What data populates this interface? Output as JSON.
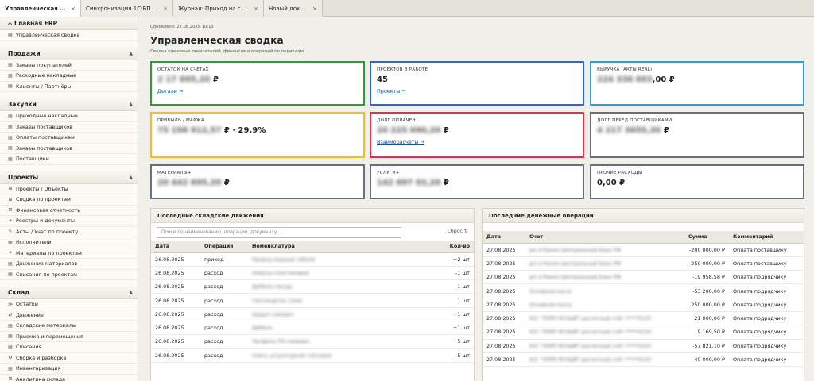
{
  "tabs": [
    {
      "label": "Управленческая сводка",
      "active": true,
      "width": 102
    },
    {
      "label": "Синхронизация 1С:БП — усл...",
      "active": false,
      "width": 116
    },
    {
      "label": "Журнал: Приход на складами",
      "active": false,
      "width": 114
    },
    {
      "label": "Новый документ",
      "active": false,
      "width": 74
    }
  ],
  "sidebar": {
    "home": {
      "title": "Главная ERP",
      "items": [
        "Управленческая сводка"
      ]
    },
    "sections": [
      {
        "title": "Продажи",
        "items": [
          {
            "icon": "▤",
            "label": "Заказы покупателей"
          },
          {
            "icon": "▤",
            "label": "Расходные накладные"
          },
          {
            "icon": "▤",
            "label": "Клиенты / Партнёры"
          }
        ]
      },
      {
        "title": "Закупки",
        "items": [
          {
            "icon": "▤",
            "label": "Приходные накладные"
          },
          {
            "icon": "▤",
            "label": "Заказы поставщиков"
          },
          {
            "icon": "▤",
            "label": "Оплаты поставщикам"
          },
          {
            "icon": "▤",
            "label": "Заказы поставщиков"
          },
          {
            "icon": "▤",
            "label": "Поставщики"
          }
        ]
      },
      {
        "title": "Проекты",
        "items": [
          {
            "icon": "⊞",
            "label": "Проекты / Объекты"
          },
          {
            "icon": "⊞",
            "label": "Сводка по проектам"
          },
          {
            "icon": "⊞",
            "label": "Финансовая отчетность"
          },
          {
            "icon": "✦",
            "label": "Реестры и документы"
          },
          {
            "icon": "✎",
            "label": "Акты / Учет по проекту"
          },
          {
            "icon": "▤",
            "label": "Исполнители"
          },
          {
            "icon": "✦",
            "label": "Материалы по проектам"
          },
          {
            "icon": "▤",
            "label": "Движение материалов"
          },
          {
            "icon": "▤",
            "label": "Списания по проектам"
          }
        ]
      },
      {
        "title": "Склад",
        "items": [
          {
            "icon": "≫",
            "label": "Остатки"
          },
          {
            "icon": "⇄",
            "label": "Движение"
          },
          {
            "icon": "▤",
            "label": "Складские материалы"
          },
          {
            "icon": "▤",
            "label": "Приемка и перемещения"
          },
          {
            "icon": "▤",
            "label": "Списания"
          },
          {
            "icon": "⚙",
            "label": "Сборка и разборка"
          },
          {
            "icon": "▤",
            "label": "Инвентаризация"
          },
          {
            "icon": "⊞",
            "label": "Аналитика склада"
          }
        ]
      }
    ]
  },
  "header": {
    "updated": "Обновлено: 27.08.2025 10:15",
    "title": "Управленческая сводка",
    "subtitle": "Сводка ключевых показателей, финансов и операций по периодам."
  },
  "cards": [
    {
      "label": "ОСТАТОК НА СЧЕТАХ",
      "blurred": "2 17 695,20",
      "value": " ₽",
      "link": "Детали →",
      "color": "#2e9a3c"
    },
    {
      "label": "ПРОЕКТОВ В РАБОТЕ",
      "blurred": "",
      "value": "45",
      "link": "Проекты →",
      "color": "#2f64d8"
    },
    {
      "label": "ВЫРУЧКА (АКТЫ REAL)",
      "blurred": "224 336 693",
      "value": ",00 ₽",
      "link": "",
      "color": "#2ea0e0"
    },
    {
      "label": "ПРИБЫЛЬ / МАРЖА",
      "blurred": "75 198 912,57",
      "value": " ₽ · 29.9%",
      "link": "",
      "color": "#f0c020"
    },
    {
      "label": "ДОЛГ ОПЛАЧЕН",
      "blurred": "20 225 690,20",
      "value": " ₽",
      "link": "Взаиморасчёты →",
      "color": "#e0304a"
    },
    {
      "label": "ДОЛГ ПЕРЕД ПОСТАВЩИКАМИ",
      "blurred": "4 217 3655,30",
      "value": " ₽",
      "link": "",
      "color": "#6a6e78"
    },
    {
      "label": "МАТЕРИАЛЫ+",
      "blurred": "20 442 695,20",
      "value": " ₽",
      "link": "",
      "color": "#6a6e78"
    },
    {
      "label": "УСЛУГИ+",
      "blurred": "142 697 03,20",
      "value": " ₽",
      "link": "",
      "color": "#6a6e78"
    },
    {
      "label": "ПРОЧИЕ РАСХОДЫ",
      "blurred": "",
      "value": "0,00 ₽",
      "link": "",
      "color": "#6a6e78"
    }
  ],
  "stock": {
    "title": "Последние складские движения",
    "search_placeholder": "Поиск по наименованию, операции, документу...",
    "reset": "Сброс ⇅",
    "columns": [
      "Дата",
      "Операция",
      "Номенклатура",
      "Кол-во"
    ],
    "rows": [
      [
        "26.08.2025",
        "приход",
        "Провод медный гибкий",
        "+2 шт"
      ],
      [
        "26.08.2025",
        "расход",
        "Хомуты пластиковые",
        "-1 шт"
      ],
      [
        "26.08.2025",
        "расход",
        "Дюбель-гвоздь",
        "-1 шт"
      ],
      [
        "26.08.2025",
        "расход",
        "Гипсокартон 12мм",
        "1 шт"
      ],
      [
        "26.08.2025",
        "расход",
        "Шуруп саморез",
        "+1 шт"
      ],
      [
        "26.08.2025",
        "расход",
        "Дюбель",
        "+1 шт"
      ],
      [
        "26.08.2025",
        "расход",
        "Профиль ПН направл.",
        "+5 шт"
      ],
      [
        "26.08.2025",
        "расход",
        "Смесь штукатурная гипсовая",
        "-5 шт"
      ]
    ]
  },
  "money": {
    "title": "Последние денежные операции",
    "columns": [
      "Дата",
      "Счет",
      "Сумма",
      "Комментарий"
    ],
    "rows": [
      [
        "27.08.2025",
        "р/с в банке Центральный Банк РФ",
        "-200 000,00 ₽",
        "Оплата поставщику"
      ],
      [
        "27.08.2025",
        "р/с в банке Центральный Банк РФ",
        "-250 000,00 ₽",
        "Оплата поставщику"
      ],
      [
        "27.08.2025",
        "р/с в банке Центральный Банк РФ",
        "-19 958,58 ₽",
        "Оплата подрядчику"
      ],
      [
        "27.08.2025",
        "Основная касса",
        "-53 200,00 ₽",
        "Оплата подрядчику"
      ],
      [
        "27.08.2025",
        "Основная касса",
        "250 000,00 ₽",
        "Оплата подрядчику"
      ],
      [
        "27.08.2025",
        "К/С \"ТЕМП ЯСНЫЙ\" расчетный счёт *****0120",
        "21 000,00 ₽",
        "Оплата подрядчику"
      ],
      [
        "27.08.2025",
        "К/С \"ТЕМП ЯСНЫЙ\" расчетный счёт *****0120",
        "9 169,50 ₽",
        "Оплата подрядчику"
      ],
      [
        "27.08.2025",
        "К/С \"ТЕМП ЯСНЫЙ\" расчетный счёт *****0120",
        "-57 821,10 ₽",
        "Оплата подрядчику"
      ],
      [
        "27.08.2025",
        "К/С \"ТЕМП ЯСНЫЙ\" расчетный счёт *****0120",
        "-40 000,00 ₽",
        "Оплата подрядчику"
      ]
    ]
  }
}
